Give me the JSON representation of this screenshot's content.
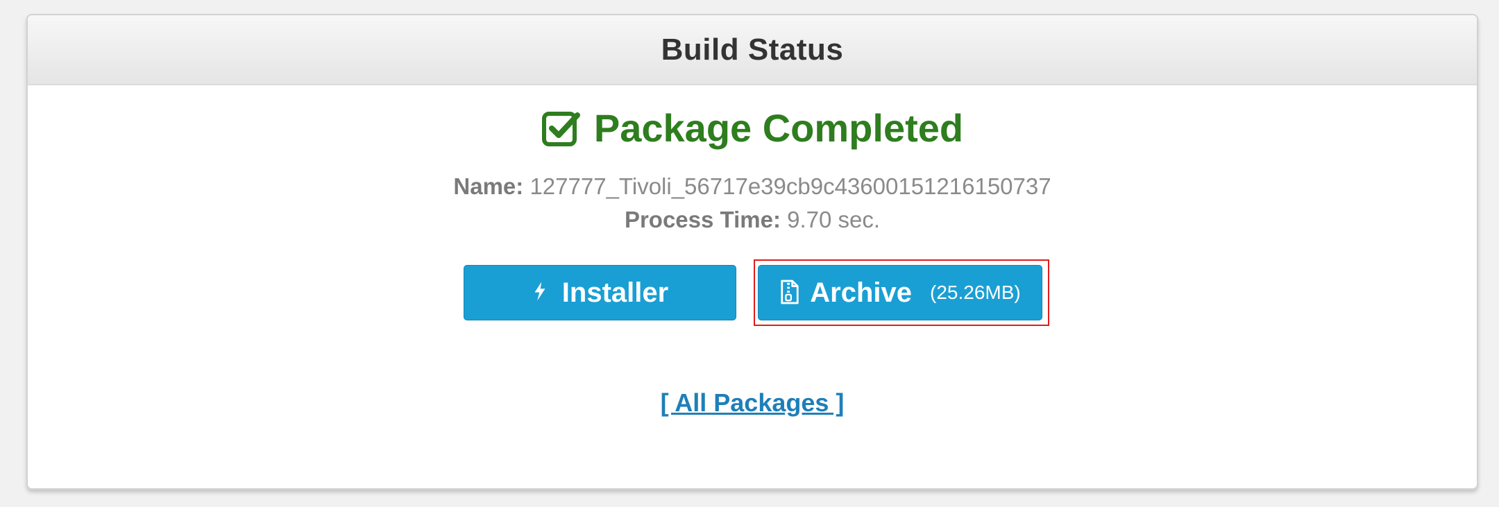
{
  "panel": {
    "title": "Build Status"
  },
  "status": {
    "text": "Package Completed",
    "icon": "check-square-icon",
    "color": "#2e7d1e"
  },
  "package": {
    "name_label": "Name:",
    "name_value": "127777_Tivoli_56717e39cb9c43600151216150737",
    "time_label": "Process Time:",
    "time_value": "9.70 sec."
  },
  "buttons": {
    "installer": {
      "label": "Installer",
      "icon": "bolt-icon"
    },
    "archive": {
      "label": "Archive",
      "size": "(25.26MB)",
      "icon": "file-zip-icon"
    },
    "color": "#1a9fd4"
  },
  "links": {
    "all_packages": "[ All Packages ]"
  },
  "highlight_color": "#e01b1b"
}
